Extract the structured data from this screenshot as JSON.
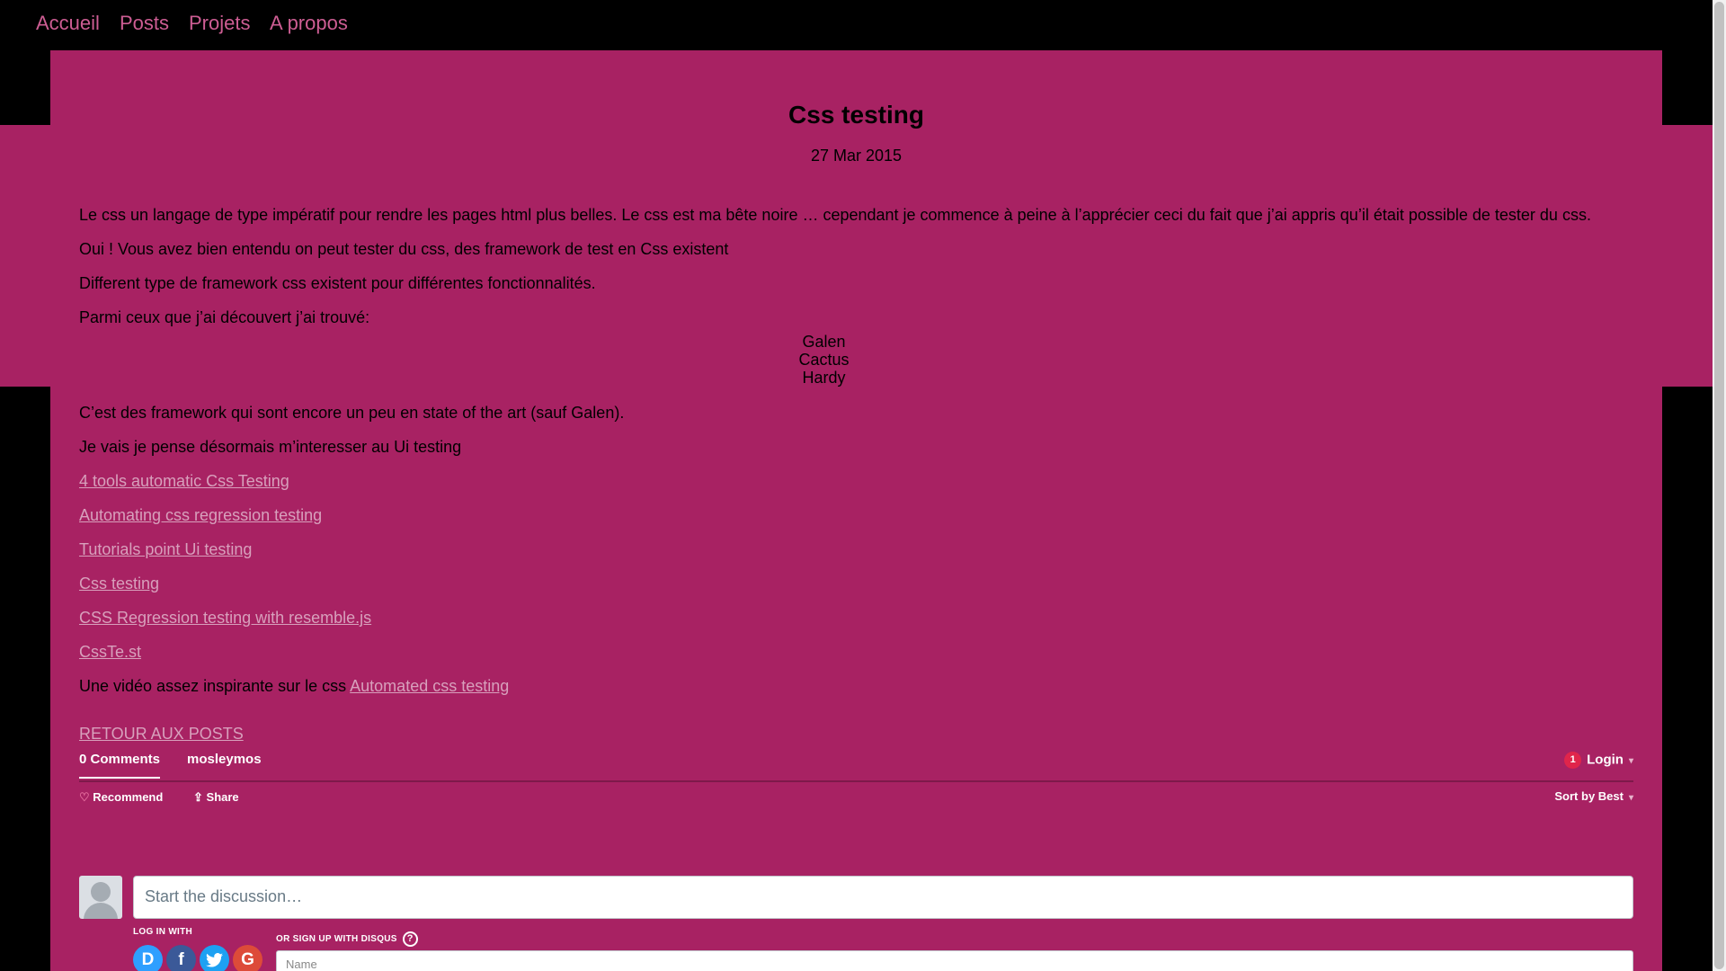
{
  "nav": {
    "items": [
      "Accueil",
      "Posts",
      "Projets",
      "A propos"
    ]
  },
  "post": {
    "title": "Css testing",
    "date": "27 Mar 2015",
    "paragraphs": [
      "Le css un langage de type impératif pour rendre les pages html plus belles. Le css est ma bête noire … cependant je commence à peine à l’apprécier ceci du fait que j’ai appris qu’il était possible de tester du css.",
      "Oui ! Vous avez bien entendu on peut tester du css, des framework de test en Css existent",
      "Different type de framework css existent pour différentes fonctionnalités.",
      "Parmi ceux que j’ai découvert j’ai trouvé:"
    ],
    "frameworks": [
      "Galen",
      "Cactus",
      "Hardy"
    ],
    "after_list": [
      "C’est des framework qui sont encore un peu en state of the art (sauf Galen).",
      "Je vais je pense désormais m’interesser au Ui testing"
    ],
    "links": [
      "4 tools automatic Css Testing",
      "Automating css regression testing",
      "Tutorials point Ui testing",
      "Css testing",
      "CSS Regression testing with resemble.js",
      "CssTe.st"
    ],
    "video_text": "Une vidéo assez inspirante sur le css",
    "video_link": "Automated css testing",
    "back_link": "RETOUR AUX POSTS"
  },
  "disqus": {
    "comments_tab": "0 Comments",
    "site_tab": "mosleymos",
    "notification_count": "1",
    "login": "Login",
    "recommend": "Recommend",
    "share": "Share",
    "sort": "Sort by Best",
    "compose_placeholder": "Start the discussion…",
    "login_with": "LOG IN WITH",
    "signup_with": "OR SIGN UP WITH DISQUS",
    "help": "?",
    "social": [
      "D",
      "f",
      "G"
    ],
    "name_placeholder": "Name"
  },
  "colors": {
    "background": "#000000",
    "card": "#a82263",
    "nav_link": "#cd5d93",
    "content_link": "#d8a0bc"
  }
}
